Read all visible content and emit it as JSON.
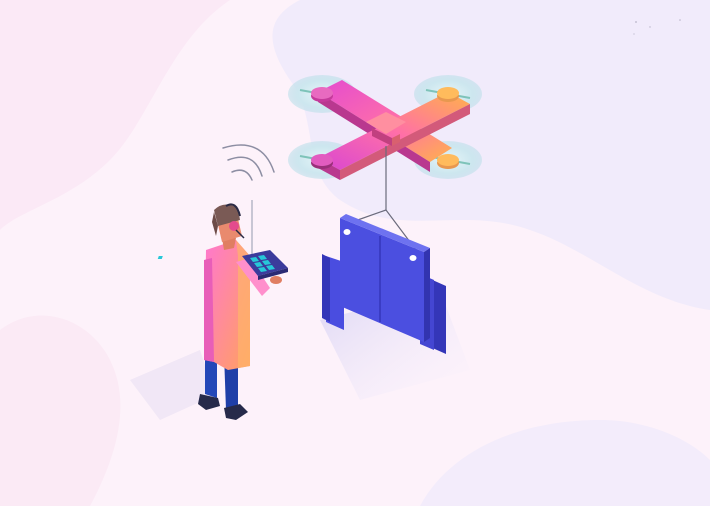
{
  "illustration": {
    "subject": "drone-delivery",
    "colors": {
      "background": "#fdf2fa",
      "blob_light": "#f3eafb",
      "blob_lavender": "#ece6fb",
      "drone_pink": "#f05fc6",
      "drone_orange": "#ffa94f",
      "drone_dark": "#9a2f7a",
      "rotor": "#cfe9f1",
      "package_blue": "#4b4fe0",
      "package_dark": "#3436b8",
      "coat": "#ff79c6",
      "pants": "#2347b8",
      "skin": "#e07e62",
      "hair": "#7a5a55",
      "tablet": "#3b3b9c",
      "tablet_screen": "#27c8d8",
      "signal": "#8d8ea3"
    },
    "icons": [
      "drone-icon",
      "package-icon",
      "signal-waves-icon",
      "operator-figure",
      "tablet-controller-icon"
    ]
  }
}
